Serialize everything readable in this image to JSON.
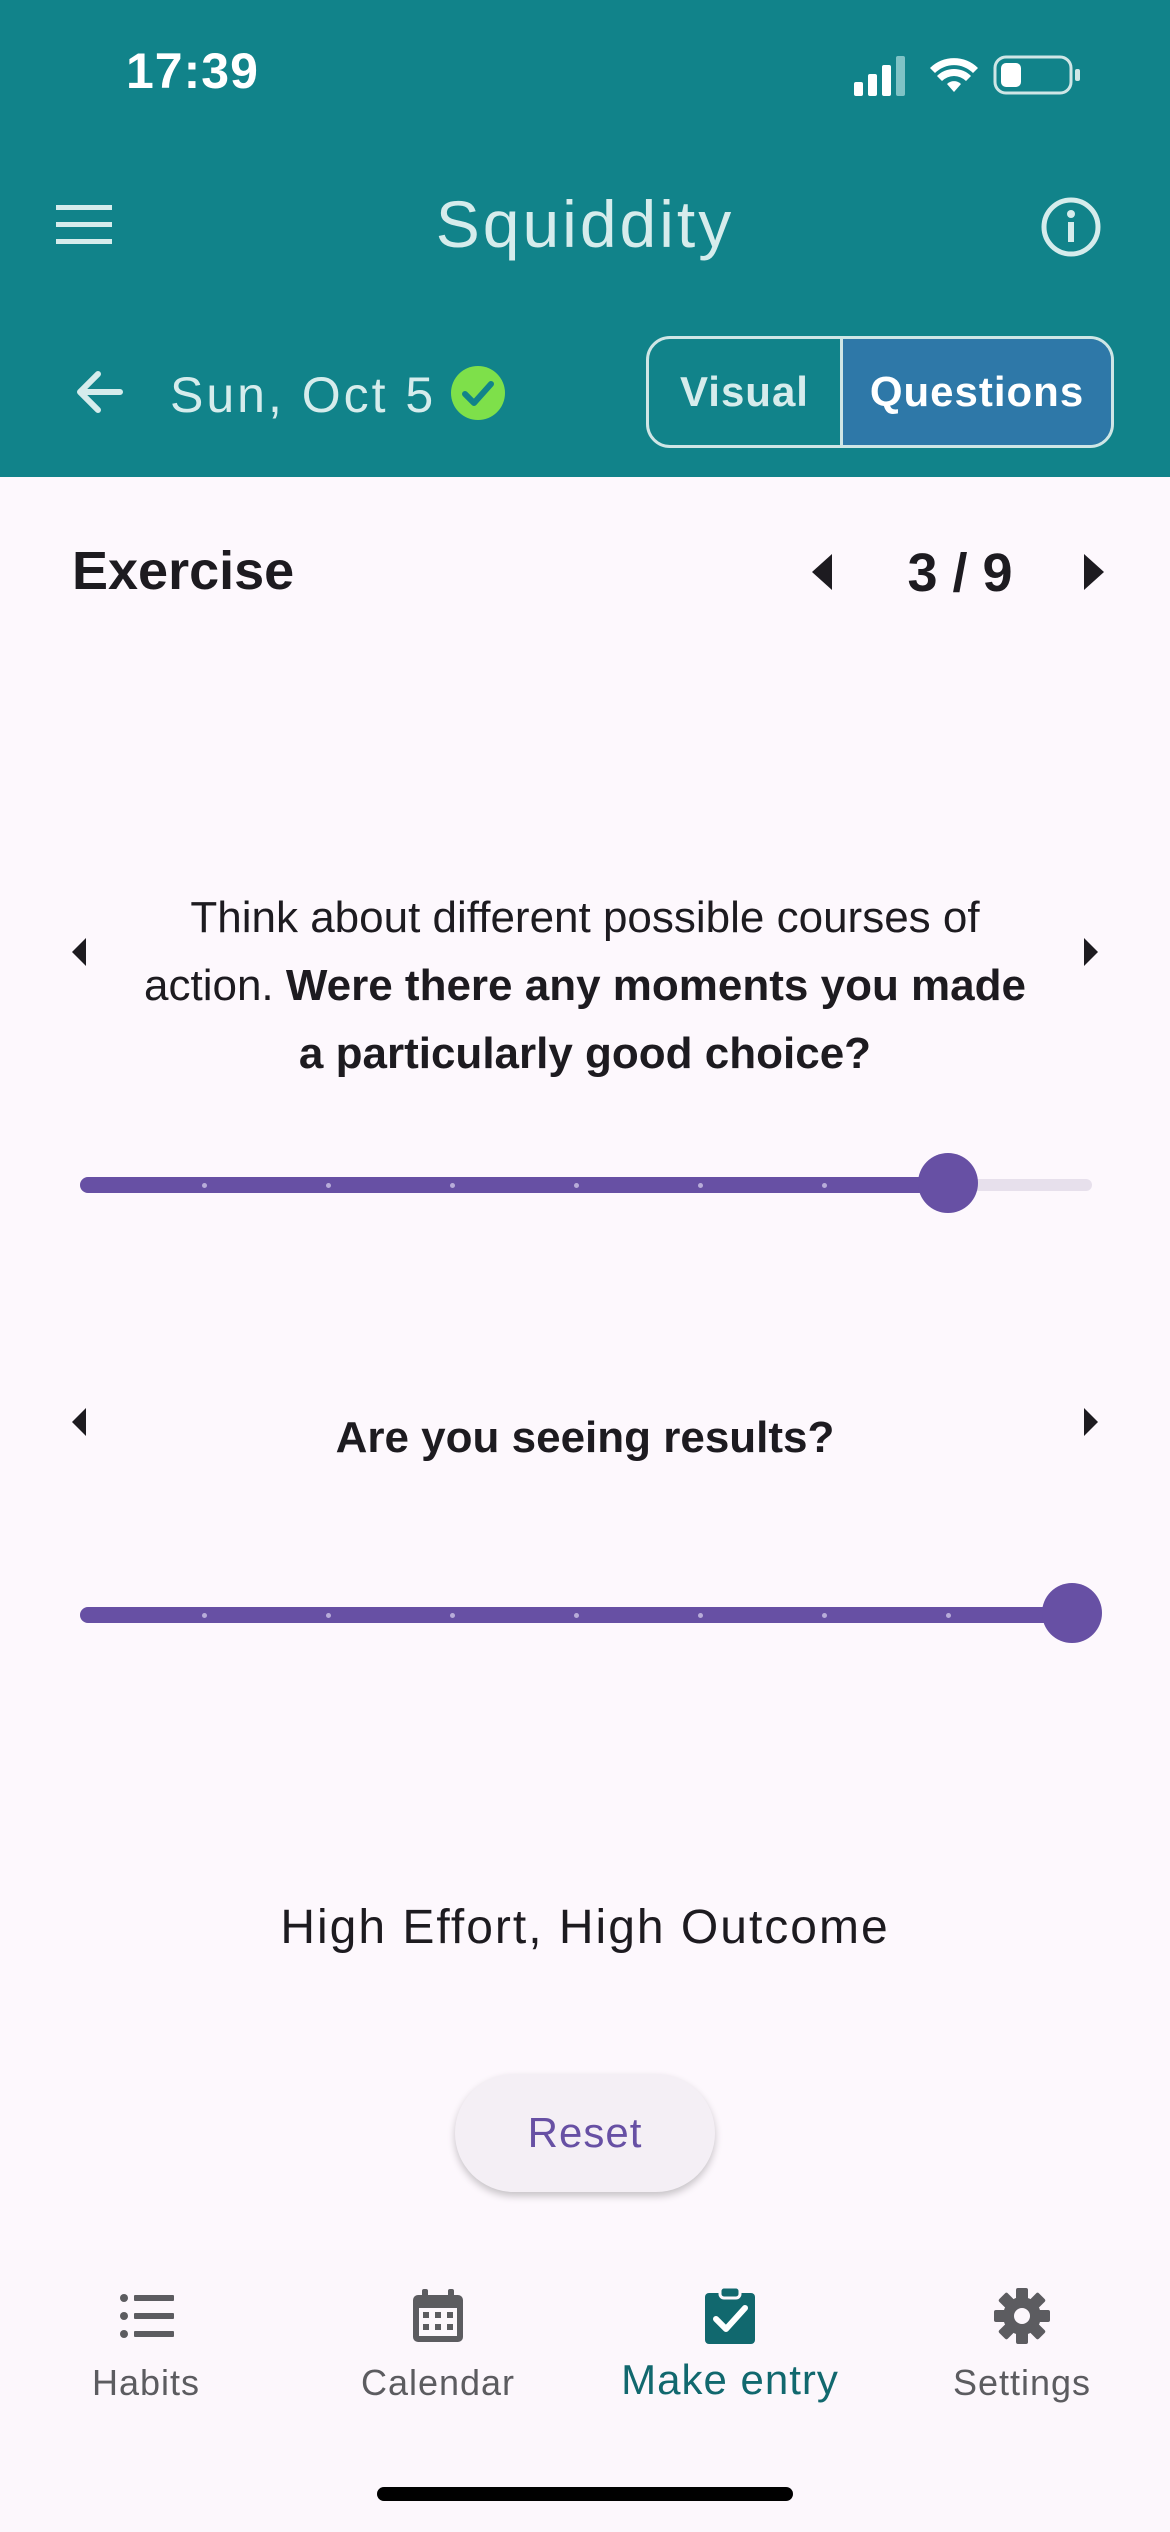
{
  "status_bar": {
    "time": "17:39"
  },
  "app": {
    "title": "Squiddity"
  },
  "date_bar": {
    "date": "Sun, Oct 5"
  },
  "view_toggle": {
    "visual_label": "Visual",
    "questions_label": "Questions",
    "selected": "Questions"
  },
  "section": {
    "title": "Exercise",
    "pager": "3 / 9"
  },
  "questions": [
    {
      "prefix": "Think about different possible courses of action. ",
      "bold": "Were there any moments you made a particularly good choice?",
      "slider_value": 0.875
    },
    {
      "prefix": "",
      "bold": "Are you seeing results?",
      "slider_value": 1.0
    }
  ],
  "result": {
    "text": "High Effort, High Outcome"
  },
  "reset": {
    "label": "Reset"
  },
  "nav": {
    "items": [
      {
        "label": "Habits",
        "icon": "list-icon"
      },
      {
        "label": "Calendar",
        "icon": "calendar-icon"
      },
      {
        "label": "Make entry",
        "icon": "clipboard-check-icon"
      },
      {
        "label": "Settings",
        "icon": "gear-icon"
      }
    ],
    "active": "Make entry"
  },
  "colors": {
    "header": "#11838A",
    "accent": "#6750A4",
    "toggle_selected": "#2E78A8",
    "check_badge": "#7EE04A",
    "active_nav": "#11686E"
  }
}
